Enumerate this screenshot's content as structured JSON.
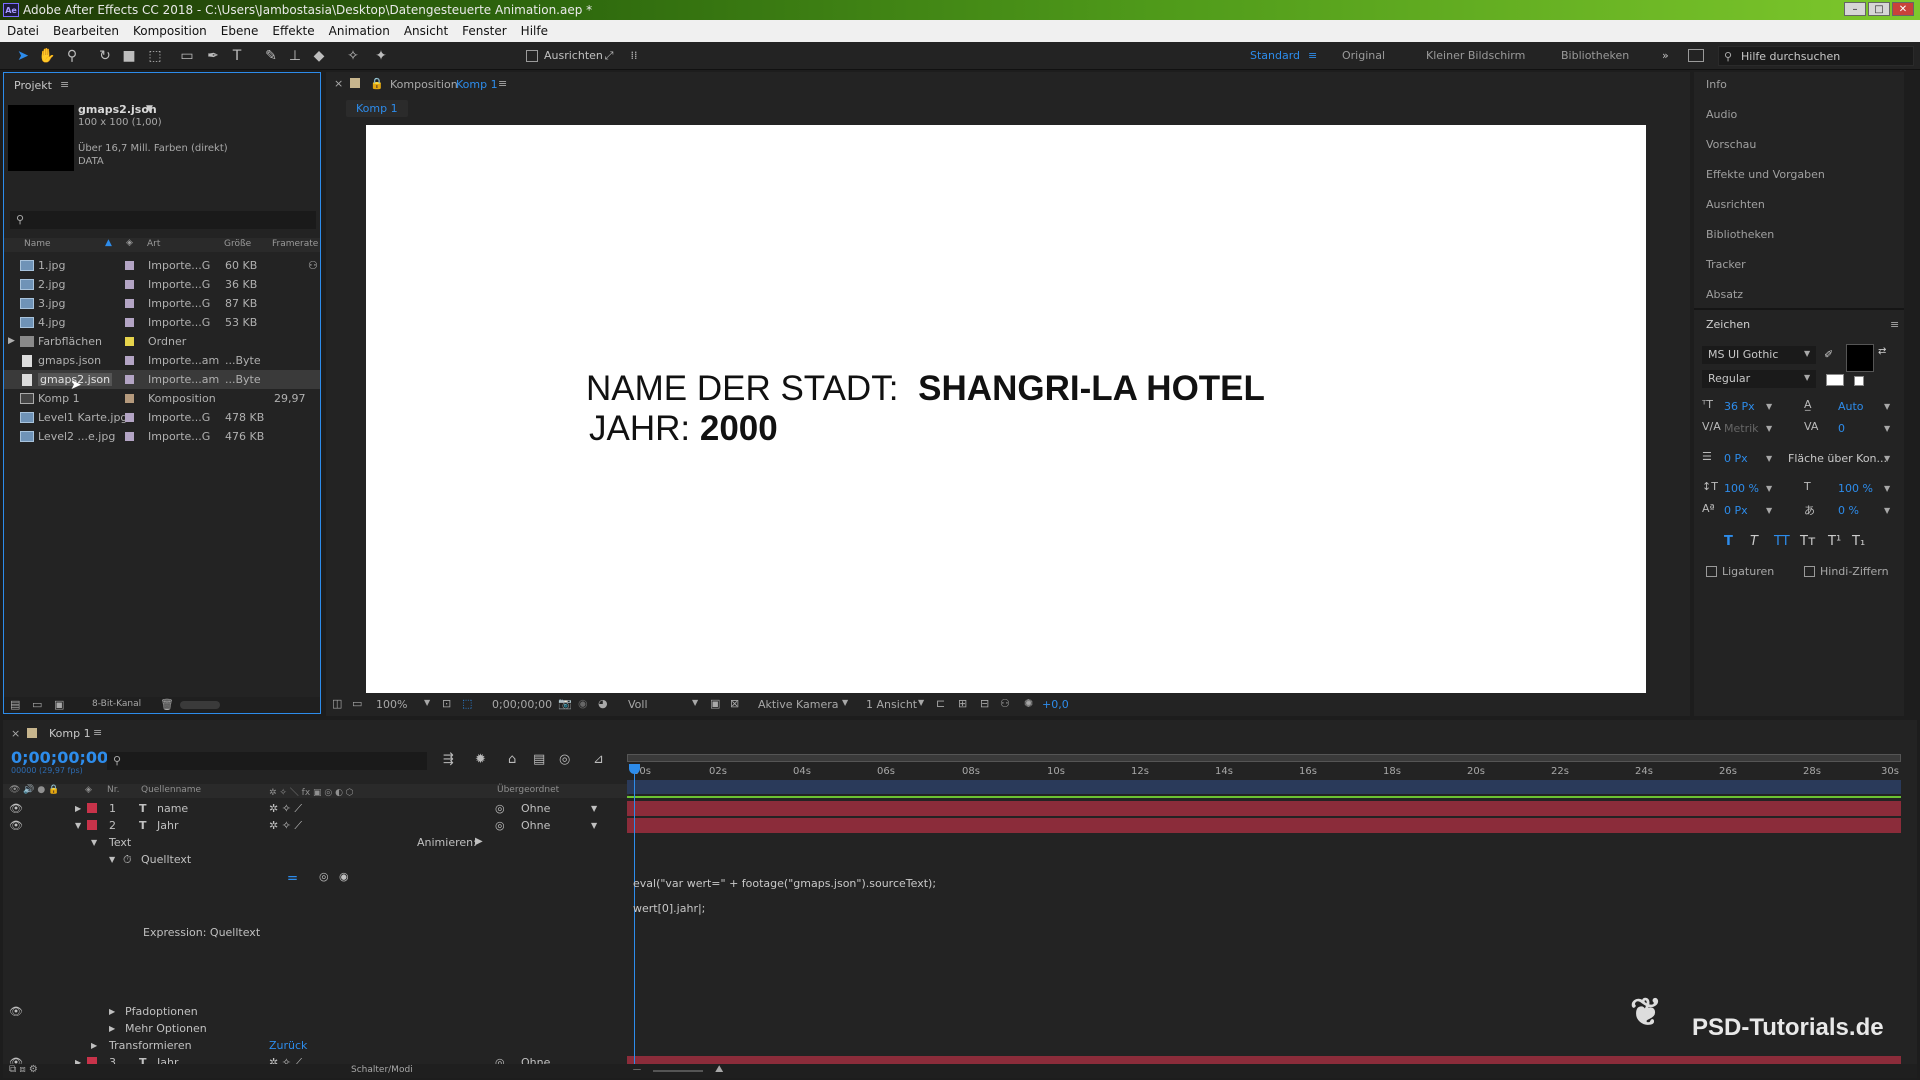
{
  "app": {
    "title": "Adobe After Effects CC 2018 - C:\\Users\\Jambostasia\\Desktop\\Datengesteuerte Animation.aep *",
    "logo": "Ae"
  },
  "menu": [
    "Datei",
    "Bearbeiten",
    "Komposition",
    "Ebene",
    "Effekte",
    "Animation",
    "Ansicht",
    "Fenster",
    "Hilfe"
  ],
  "toolbar": {
    "align_label": "Ausrichten",
    "workspaces": [
      "Standard",
      "Original",
      "Kleiner Bildschirm",
      "Bibliotheken"
    ],
    "active_workspace": "Standard",
    "search_placeholder": "Hilfe durchsuchen"
  },
  "project": {
    "tab": "Projekt",
    "selected_name": "gmaps2.json",
    "info_line1": "100 x 100 (1,00)",
    "info_line2": "Über 16,7 Mill. Farben (direkt)",
    "info_line3": "DATA",
    "columns": [
      "Name",
      "Art",
      "Größe",
      "Framerate"
    ],
    "items": [
      {
        "name": "1.jpg",
        "type": "Importe...G",
        "size": "60 KB",
        "rate": "",
        "icon": "image-file-icon"
      },
      {
        "name": "2.jpg",
        "type": "Importe...G",
        "size": "36 KB",
        "rate": "",
        "icon": "image-file-icon"
      },
      {
        "name": "3.jpg",
        "type": "Importe...G",
        "size": "87 KB",
        "rate": "",
        "icon": "image-file-icon"
      },
      {
        "name": "4.jpg",
        "type": "Importe...G",
        "size": "53 KB",
        "rate": "",
        "icon": "image-file-icon"
      },
      {
        "name": "Farbflächen",
        "type": "Ordner",
        "size": "",
        "rate": "",
        "icon": "folder-icon"
      },
      {
        "name": "gmaps.json",
        "type": "Importe...am",
        "size": "...Byte",
        "rate": "",
        "icon": "json-file-icon"
      },
      {
        "name": "gmaps2.json",
        "type": "Importe...am",
        "size": "...Byte",
        "rate": "",
        "icon": "json-file-icon"
      },
      {
        "name": "Komp 1",
        "type": "Komposition",
        "size": "",
        "rate": "29,97",
        "icon": "composition-icon"
      },
      {
        "name": "Level1 Karte.jpg",
        "type": "Importe...G",
        "size": "478 KB",
        "rate": "",
        "icon": "image-file-icon"
      },
      {
        "name": "Level2 ...e.jpg",
        "type": "Importe...G",
        "size": "476 KB",
        "rate": "",
        "icon": "image-file-icon"
      }
    ],
    "bit_depth": "8-Bit-Kanal"
  },
  "composition": {
    "panel_prefix": "Komposition",
    "name": "Komp 1",
    "subtab": "Komp 1",
    "text_line1_label": "NAME DER STADT:",
    "text_line1_value": "SHANGRI-LA HOTEL",
    "text_line2_label": "JAHR:",
    "text_line2_value": "2000",
    "zoom": "100%",
    "timecode": "0;00;00;00",
    "resolution": "Voll",
    "camera": "Aktive Kamera",
    "views": "1 Ansicht",
    "exposure": "+0,0"
  },
  "right_panels": [
    "Info",
    "Audio",
    "Vorschau",
    "Effekte und Vorgaben",
    "Ausrichten",
    "Bibliotheken",
    "Tracker",
    "Absatz"
  ],
  "character": {
    "title": "Zeichen",
    "font": "MS UI Gothic",
    "style": "Regular",
    "size": "36 Px",
    "leading": "Auto",
    "kerning": "Metrik",
    "tracking": "0",
    "stroke_width": "0 Px",
    "stroke_mode": "Fläche über Kon...",
    "vscale": "100 %",
    "hscale": "100 %",
    "baseline": "0 Px",
    "tsume": "0 %",
    "ligatures": "Ligaturen",
    "hindi": "Hindi-Ziffern"
  },
  "timeline": {
    "tab": "Komp 1",
    "timecode": "0;00;00;00",
    "frames": "00000 (29,97 fps)",
    "cols": {
      "nr": "Nr.",
      "source": "Quellenname",
      "parent": "Übergeordnet"
    },
    "ticks": [
      "00s",
      "02s",
      "04s",
      "06s",
      "08s",
      "10s",
      "12s",
      "14s",
      "16s",
      "18s",
      "20s",
      "22s",
      "24s",
      "26s",
      "28s",
      "30s"
    ],
    "layers": [
      {
        "nr": "1",
        "name": "name",
        "parent": "Ohne"
      },
      {
        "nr": "2",
        "name": "Jahr",
        "parent": "Ohne"
      },
      {
        "nr": "3",
        "name": "Jahr",
        "parent": "Ohne"
      }
    ],
    "text_group": "Text",
    "animate": "Animieren:",
    "source_text": "Quelltext",
    "expression_label": "Expression: Quelltext",
    "expression_line1": "eval(\"var wert=\" + footage(\"gmaps.json\").sourceText);",
    "expression_line2": "wert[0].jahr|;",
    "path_options": "Pfadoptionen",
    "more_options": "Mehr Optionen",
    "transform": "Transformieren",
    "reset": "Zurück",
    "switches": "Schalter/Modi"
  },
  "watermark": "PSD-Tutorials.de",
  "colors": {
    "accent": "#2d8ceb",
    "layer_bar": "#8b2c3a",
    "layer_label": "#c8334a"
  }
}
